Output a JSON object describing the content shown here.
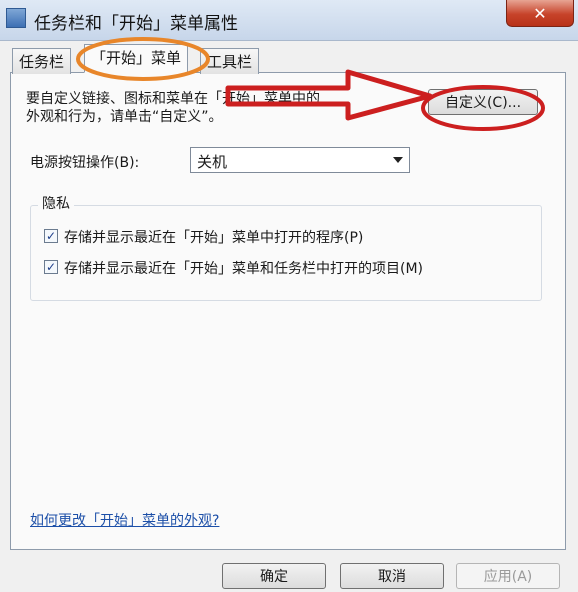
{
  "window": {
    "title": "任务栏和「开始」菜单属性",
    "close_glyph": "✕"
  },
  "tabs": [
    {
      "label": "任务栏"
    },
    {
      "label": "「开始」菜单"
    },
    {
      "label": "工具栏"
    }
  ],
  "customize": {
    "description": "要自定义链接、图标和菜单在「开始」菜单中的\n外观和行为，请单击“自定义”。",
    "button_label": "自定义(C)..."
  },
  "power": {
    "label": "电源按钮操作(B):",
    "selected": "关机"
  },
  "privacy": {
    "title": "隐私",
    "options": [
      {
        "label": "存储并显示最近在「开始」菜单中打开的程序(P)",
        "checked": true
      },
      {
        "label": "存储并显示最近在「开始」菜单和任务栏中打开的项目(M)",
        "checked": true
      }
    ]
  },
  "help_link": "如何更改「开始」菜单的外观?",
  "footer": {
    "ok": "确定",
    "cancel": "取消",
    "apply": "应用(A)"
  },
  "annotations": {
    "highlight_color": "#e8862a",
    "arrow_color": "#cc1f1f"
  }
}
